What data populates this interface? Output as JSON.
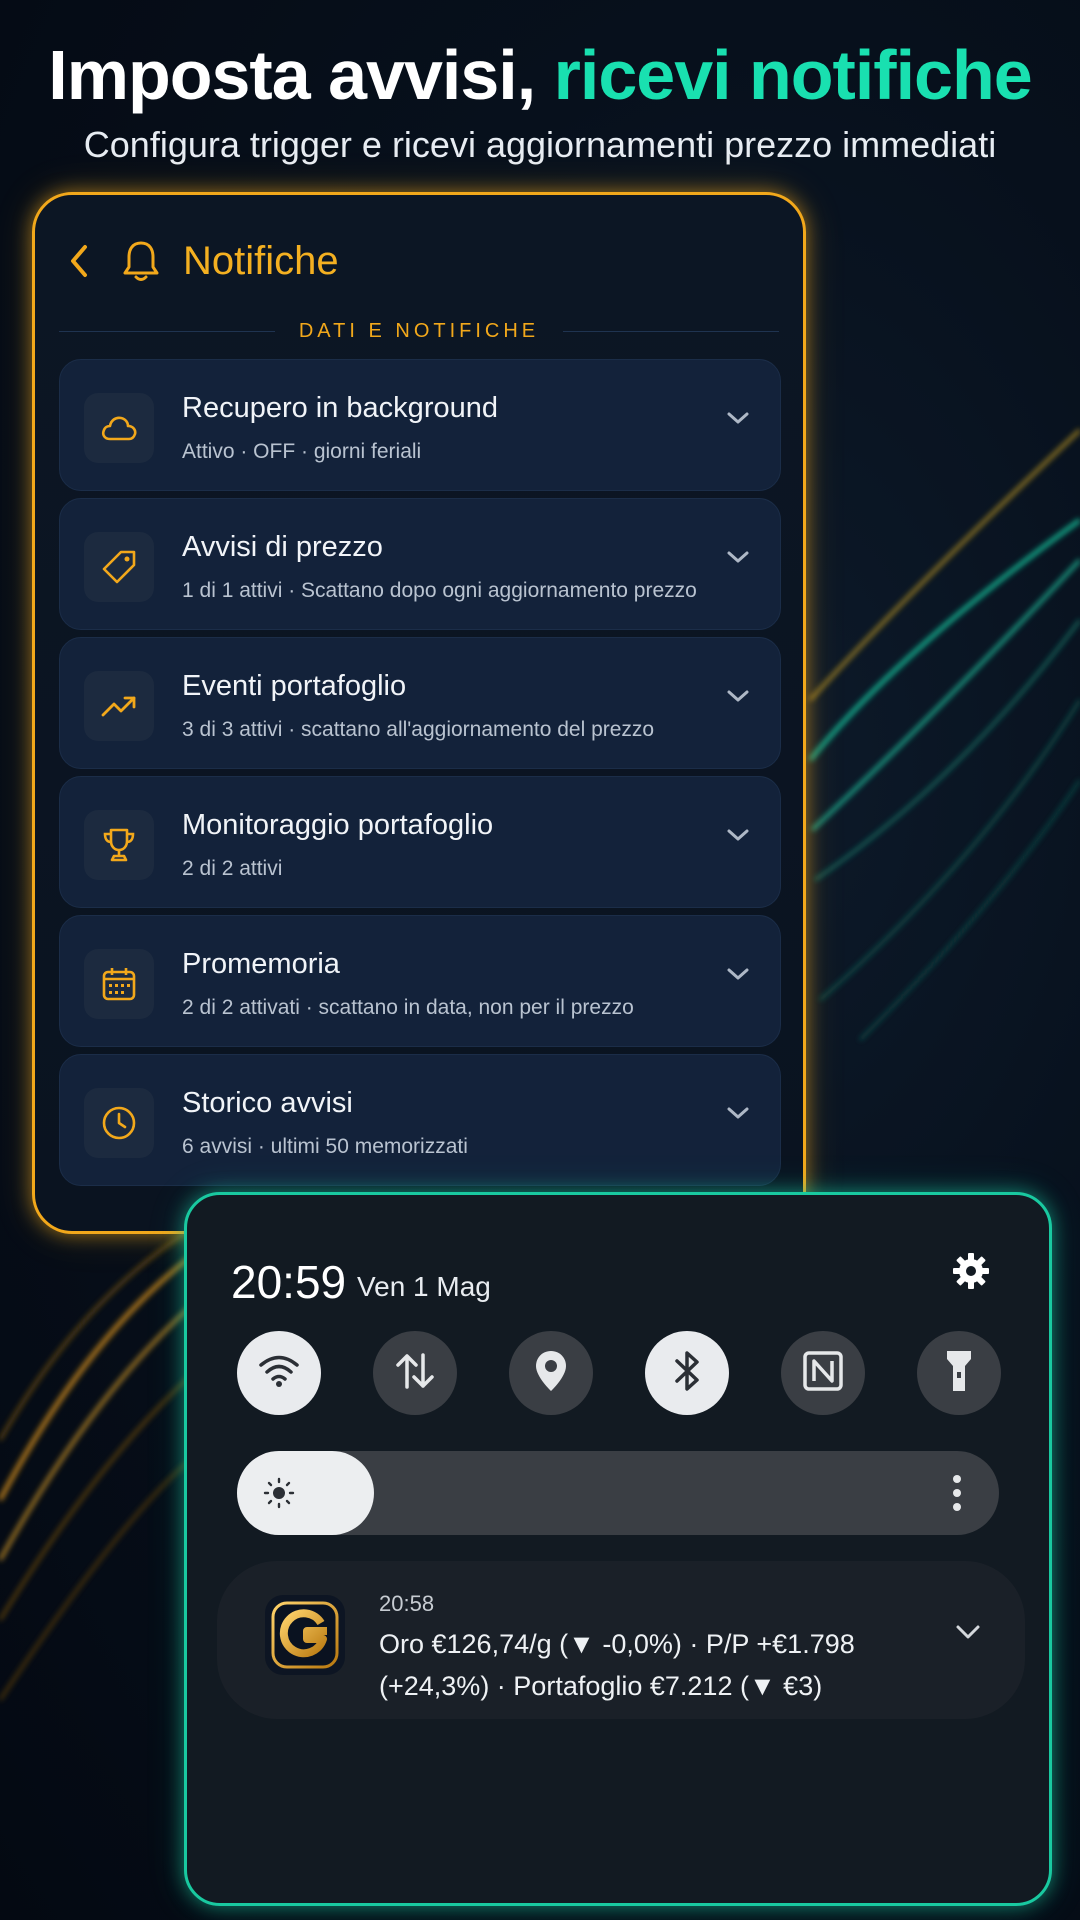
{
  "hero": {
    "title_part1": "Imposta avvisi, ",
    "title_part2": "ricevi notifiche",
    "subtitle": "Configura trigger e ricevi aggiornamenti prezzo immediati"
  },
  "card": {
    "title": "Notifiche",
    "section_label": "DATI E NOTIFICHE",
    "rows": [
      {
        "icon": "cloud-icon",
        "title": "Recupero in background",
        "subtitle": "Attivo · OFF · giorni feriali"
      },
      {
        "icon": "tag-icon",
        "title": "Avvisi di prezzo",
        "subtitle": "1 di 1 attivi  ·  Scattano dopo ogni aggiornamento prezzo"
      },
      {
        "icon": "trending-up-icon",
        "title": "Eventi portafoglio",
        "subtitle": "3 di 3 attivi  ·  scattano all'aggiornamento del prezzo"
      },
      {
        "icon": "trophy-icon",
        "title": "Monitoraggio portafoglio",
        "subtitle": "2 di 2 attivi"
      },
      {
        "icon": "calendar-icon",
        "title": "Promemoria",
        "subtitle": "2 di 2 attivati  ·  scattano in data, non per il prezzo"
      },
      {
        "icon": "clock-icon",
        "title": "Storico avvisi",
        "subtitle": "6 avvisi  ·  ultimi 50 memorizzati"
      }
    ]
  },
  "panel": {
    "time": "20:59",
    "date": "Ven 1 Mag",
    "tiles": [
      {
        "icon": "wifi-icon",
        "active": true
      },
      {
        "icon": "data-transfer-icon",
        "active": false
      },
      {
        "icon": "location-icon",
        "active": false
      },
      {
        "icon": "bluetooth-icon",
        "active": true
      },
      {
        "icon": "nfc-icon",
        "active": false
      },
      {
        "icon": "flashlight-icon",
        "active": false
      }
    ],
    "brightness_level": 0.18,
    "notification": {
      "time": "20:58",
      "text": "Oro €126,74/g (▼  -0,0%) · P/P +€1.798 (+24,3%) · Portafoglio €7.212 (▼  €3)"
    }
  },
  "colors": {
    "gold": "#f2a81b",
    "teal": "#19e0b0"
  }
}
